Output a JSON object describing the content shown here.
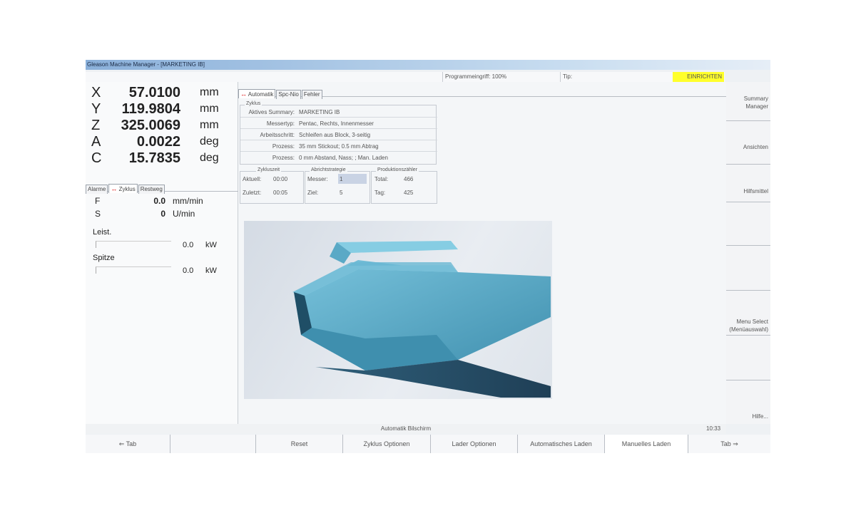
{
  "window": {
    "title": "Gleason Machine Manager - [MARKETING IB]"
  },
  "status": {
    "program_access": "Programmeingriff: 100%",
    "tip": "Tip:",
    "mode": "EINRICHTEN",
    "mode_color": "#ffff2b"
  },
  "axes": [
    {
      "axis": "X",
      "value": "57.0100",
      "unit": "mm"
    },
    {
      "axis": "Y",
      "value": "119.9804",
      "unit": "mm"
    },
    {
      "axis": "Z",
      "value": "325.0069",
      "unit": "mm"
    },
    {
      "axis": "A",
      "value": "0.0022",
      "unit": "deg"
    },
    {
      "axis": "C",
      "value": "15.7835",
      "unit": "deg"
    }
  ],
  "left_tabs": {
    "alarme": "Alarme",
    "zyklus": "Zyklus",
    "restweg": "Restweg",
    "active": "Zyklus"
  },
  "feed": {
    "label": "F",
    "value": "0.0",
    "unit": "mm/min"
  },
  "spindle": {
    "label": "S",
    "value": "0",
    "unit": "U/min"
  },
  "leist": {
    "label": "Leist.",
    "value": "0.0",
    "unit": "kW"
  },
  "spitze": {
    "label": "Spitze",
    "value": "0.0",
    "unit": "kW"
  },
  "main_tabs": {
    "automatik": "Automatik",
    "spc": "Spc-Nio",
    "fehler": "Fehler",
    "active": "Automatik"
  },
  "zyklus": {
    "legend": "Zyklus",
    "rows": [
      {
        "key": "Aktives Summary:",
        "value": "MARKETING IB"
      },
      {
        "key": "Messertyp:",
        "value": "Pentac, Rechts, Innenmesser"
      },
      {
        "key": "Arbeitsschritt:",
        "value": "Schleifen aus Block, 3-seitig"
      },
      {
        "key": "Prozess:",
        "value": "35 mm Stickout; 0.5 mm Abtrag"
      },
      {
        "key": "Prozess:",
        "value": "0 mm Abstand, Nass; ; Man. Laden"
      }
    ]
  },
  "zykluszeit": {
    "legend": "Zykluszeit",
    "aktuell_label": "Aktuell:",
    "aktuell": "00:00",
    "zuletzt_label": "Zuletzt:",
    "zuletzt": "00:05"
  },
  "abrichtstrategie": {
    "legend": "Abrichtstrategie",
    "messer_label": "Messer:",
    "messer": "1",
    "ziel_label": "Ziel:",
    "ziel": "5"
  },
  "produktionszaehler": {
    "legend": "Produktionszähler",
    "total_label": "Total:",
    "total": "466",
    "tag_label": "Tag:",
    "tag": "425"
  },
  "softkeys": {
    "summary_manager_line1": "Summary",
    "summary_manager_line2": "Manager",
    "ansichten": "Ansichten",
    "hilfsmittel": "Hilfsmittel",
    "menu_select_line1": "Menu Select",
    "menu_select_line2": "(Menüauswahl)",
    "hilfe": "Hilfe..."
  },
  "infobar": {
    "screen": "Automatik Bilschirm",
    "time": "10:33"
  },
  "bottom_keys": {
    "tab_left": "⇐ Tab",
    "reset": "Reset",
    "zyklus_optionen": "Zyklus Optionen",
    "lader_optionen": "Lader Optionen",
    "automatisches_laden": "Automatisches Laden",
    "manuelles_laden": "Manuelles Laden",
    "tab_right": "Tab ⇒"
  },
  "colors": {
    "accent_arrow": "#dd1111",
    "tool_blue": "#4ea3c4"
  }
}
